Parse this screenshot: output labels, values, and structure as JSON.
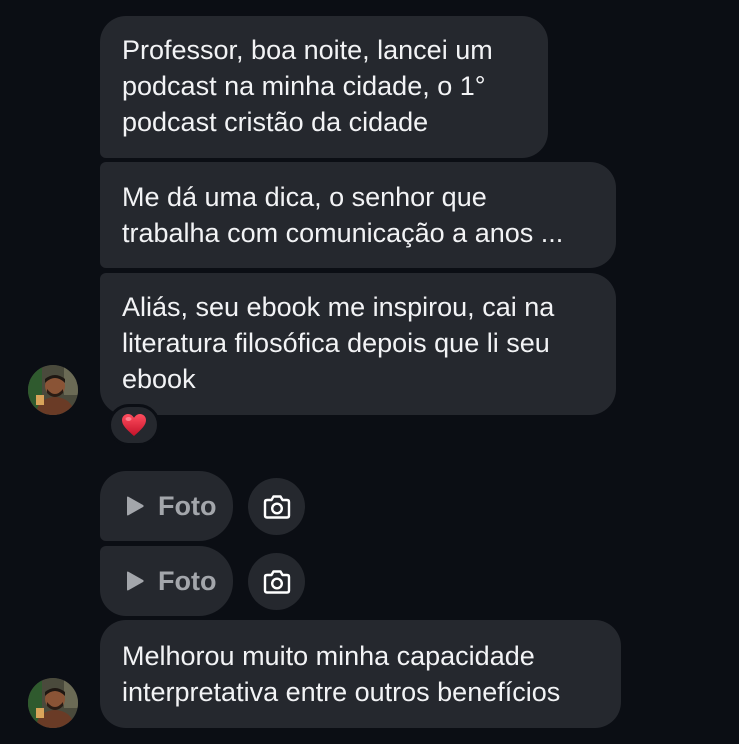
{
  "messages": [
    {
      "text": "Professor, boa noite, lancei um\npodcast na minha cidade, o 1°\npodcast cristão da cidade"
    },
    {
      "text": "Me dá uma dica, o senhor que\ntrabalha com comunicação a anos ..."
    },
    {
      "text": "Aliás, seu ebook me inspirou, cai na\nliteratura filosófica depois que li seu\nebook"
    },
    {
      "text": "Melhorou muito minha capacidade\ninterpretativa entre outros benefícios"
    }
  ],
  "reaction": {
    "emoji": "heart-icon",
    "color": "#e0263d"
  },
  "media": [
    {
      "label": "Foto",
      "icon": "play-icon"
    },
    {
      "label": "Foto",
      "icon": "play-icon"
    }
  ],
  "colors": {
    "background": "#0b0e14",
    "bubble": "#25282e",
    "text": "#f2f3f5",
    "muted": "#a3a6ab"
  }
}
